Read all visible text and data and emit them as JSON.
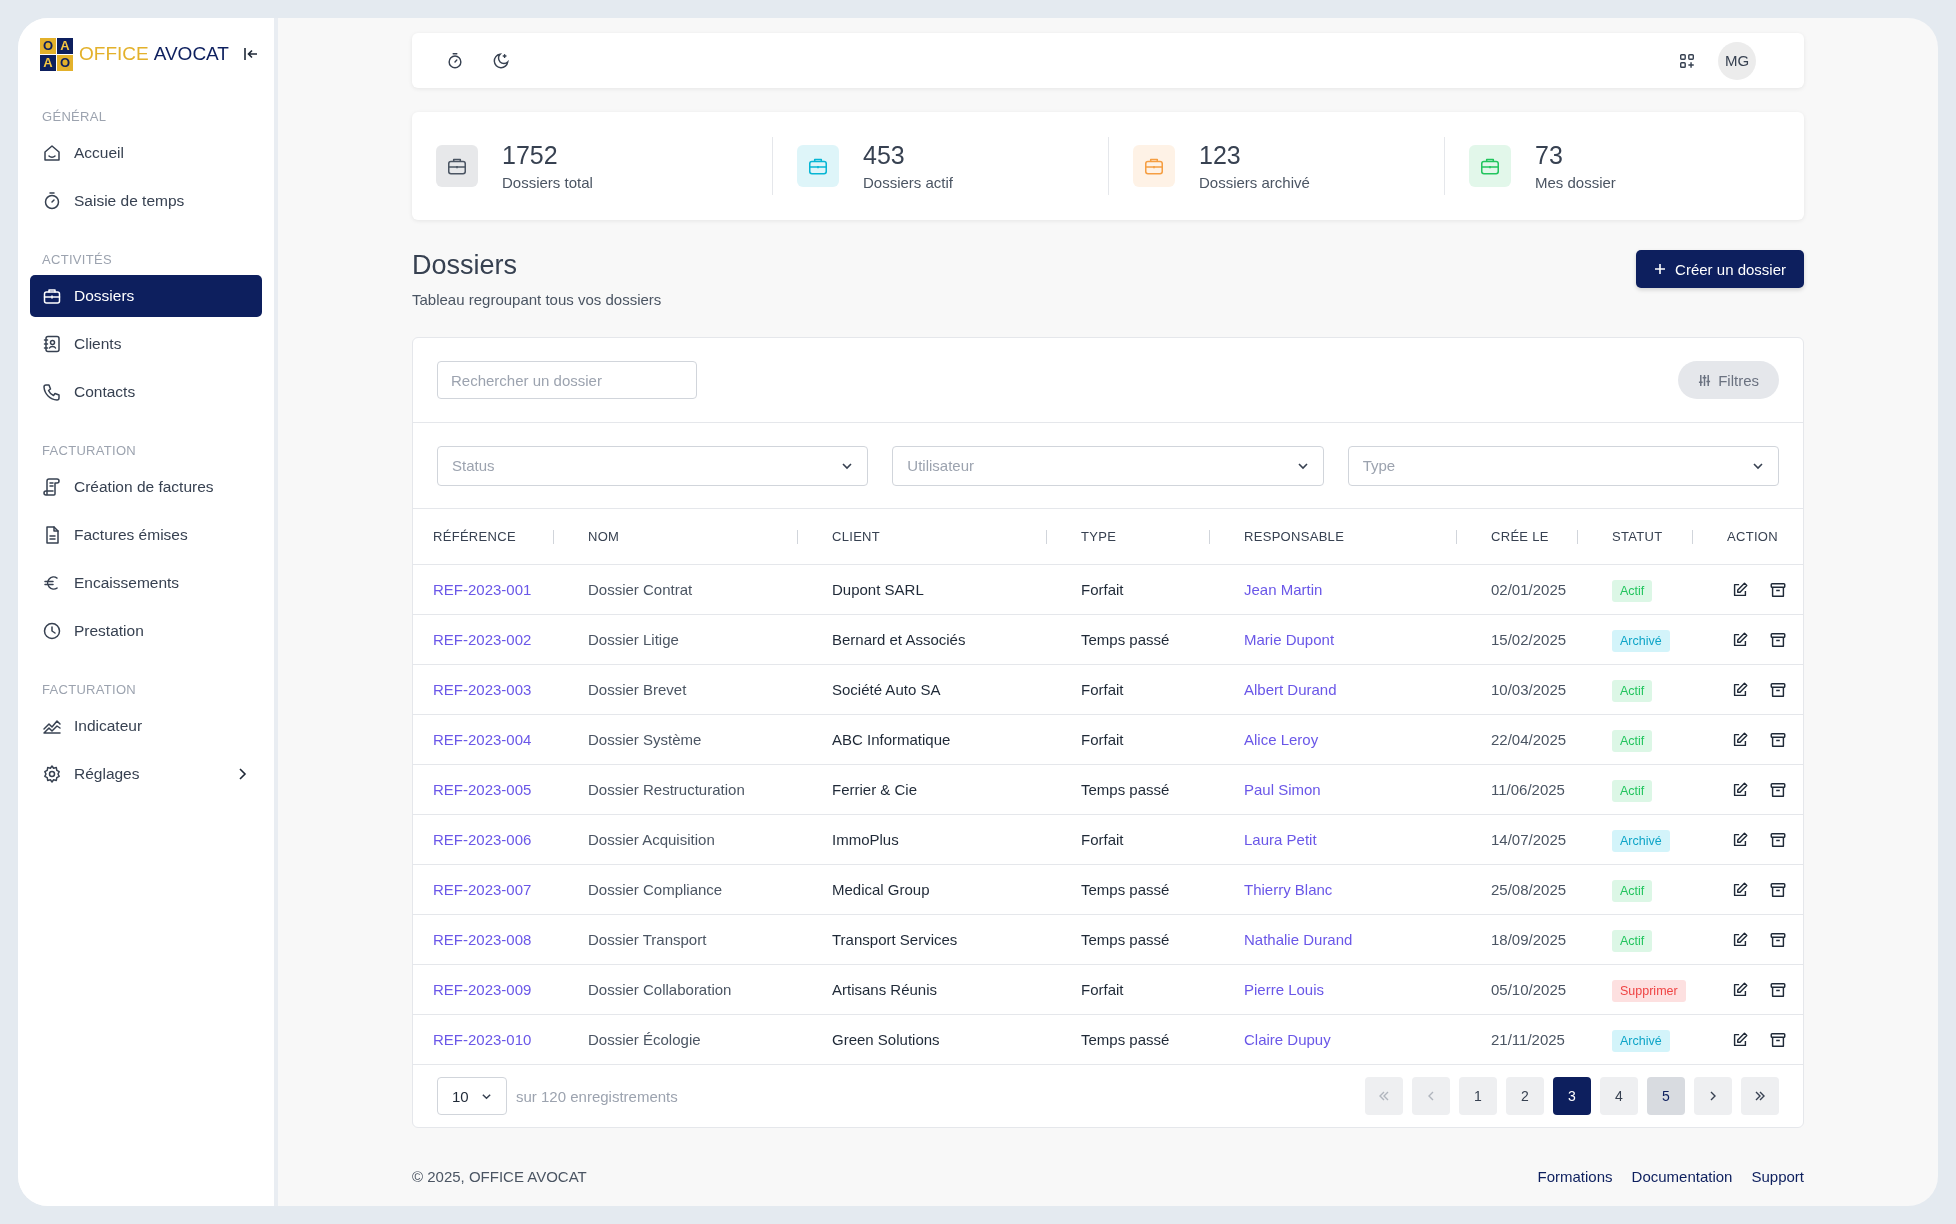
{
  "logo": {
    "tiles": [
      "O",
      "A",
      "A",
      "O"
    ],
    "word1": "OFFICE",
    "word2": "AVOCAT"
  },
  "sidebar": {
    "sections": [
      {
        "label": "GÉNÉRAL",
        "items": [
          {
            "label": "Accueil",
            "selected": false
          },
          {
            "label": "Saisie de temps",
            "selected": false
          }
        ]
      },
      {
        "label": "ACTIVITÉS",
        "items": [
          {
            "label": "Dossiers",
            "selected": true
          },
          {
            "label": "Clients",
            "selected": false
          },
          {
            "label": "Contacts",
            "selected": false
          }
        ]
      },
      {
        "label": "FACTURATION",
        "items": [
          {
            "label": "Création de factures",
            "selected": false
          },
          {
            "label": "Factures émises",
            "selected": false
          },
          {
            "label": "Encaissements",
            "selected": false
          },
          {
            "label": "Prestation",
            "selected": false
          }
        ]
      },
      {
        "label": "FACTURATION",
        "items": [
          {
            "label": "Indicateur",
            "selected": false
          },
          {
            "label": "Réglages",
            "selected": false,
            "submenu": true
          }
        ]
      }
    ]
  },
  "topbar": {
    "avatar": "MG"
  },
  "stats": [
    {
      "value": "1752",
      "label": "Dossiers total",
      "color": "#4b5563"
    },
    {
      "value": "453",
      "label": "Dossiers actif",
      "color": "#06b6d4"
    },
    {
      "value": "123",
      "label": "Dossiers archivé",
      "color": "#f59e42"
    },
    {
      "value": "73",
      "label": "Mes dossier",
      "color": "#22c55e"
    }
  ],
  "page": {
    "title": "Dossiers",
    "subtitle": "Tableau regroupant tous vos dossiers",
    "create_button": "Créer un dossier"
  },
  "search": {
    "placeholder": "Rechercher un dossier"
  },
  "filters_button": "Filtres",
  "filters": [
    {
      "placeholder": "Status"
    },
    {
      "placeholder": "Utilisateur"
    },
    {
      "placeholder": "Type"
    }
  ],
  "table": {
    "columns": [
      "RÉFÉRENCE",
      "NOM",
      "CLIENT",
      "TYPE",
      "RESPONSABLE",
      "CRÉE LE",
      "STATUT",
      "ACTION"
    ],
    "rows": [
      {
        "reference": "REF-2023-001",
        "nom": "Dossier Contrat",
        "client": "Dupont SARL",
        "type": "Forfait",
        "responsable": "Jean Martin",
        "cree_le": "02/01/2025",
        "statut": {
          "label": "Actif",
          "kind": "active"
        }
      },
      {
        "reference": "REF-2023-002",
        "nom": "Dossier Litige",
        "client": "Bernard et Associés",
        "type": "Temps passé",
        "responsable": "Marie Dupont",
        "cree_le": "15/02/2025",
        "statut": {
          "label": "Archivé",
          "kind": "archived"
        }
      },
      {
        "reference": "REF-2023-003",
        "nom": "Dossier Brevet",
        "client": "Société Auto SA",
        "type": "Forfait",
        "responsable": "Albert Durand",
        "cree_le": "10/03/2025",
        "statut": {
          "label": "Actif",
          "kind": "active"
        }
      },
      {
        "reference": "REF-2023-004",
        "nom": "Dossier Système",
        "client": "ABC Informatique",
        "type": "Forfait",
        "responsable": "Alice Leroy",
        "cree_le": "22/04/2025",
        "statut": {
          "label": "Actif",
          "kind": "active"
        }
      },
      {
        "reference": "REF-2023-005",
        "nom": "Dossier Restructuration",
        "client": "Ferrier & Cie",
        "type": "Temps passé",
        "responsable": "Paul Simon",
        "cree_le": "11/06/2025",
        "statut": {
          "label": "Actif",
          "kind": "active"
        }
      },
      {
        "reference": "REF-2023-006",
        "nom": "Dossier Acquisition",
        "client": "ImmoPlus",
        "type": "Forfait",
        "responsable": "Laura Petit",
        "cree_le": "14/07/2025",
        "statut": {
          "label": "Archivé",
          "kind": "archived"
        }
      },
      {
        "reference": "REF-2023-007",
        "nom": "Dossier Compliance",
        "client": "Medical Group",
        "type": "Temps passé",
        "responsable": "Thierry Blanc",
        "cree_le": "25/08/2025",
        "statut": {
          "label": "Actif",
          "kind": "active"
        }
      },
      {
        "reference": "REF-2023-008",
        "nom": "Dossier Transport",
        "client": "Transport Services",
        "type": "Temps passé",
        "responsable": "Nathalie Durand",
        "cree_le": "18/09/2025",
        "statut": {
          "label": "Actif",
          "kind": "active"
        }
      },
      {
        "reference": "REF-2023-009",
        "nom": "Dossier Collaboration",
        "client": "Artisans Réunis",
        "type": "Forfait",
        "responsable": "Pierre Louis",
        "cree_le": "05/10/2025",
        "statut": {
          "label": "Supprimer",
          "kind": "deleted"
        }
      },
      {
        "reference": "REF-2023-010",
        "nom": "Dossier Écologie",
        "client": "Green Solutions",
        "type": "Temps passé",
        "responsable": "Claire Dupuy",
        "cree_le": "21/11/2025",
        "statut": {
          "label": "Archivé",
          "kind": "archived"
        }
      }
    ]
  },
  "pagination": {
    "per_page": "10",
    "summary": "sur 120 enregistrements",
    "first_disabled": true,
    "prev_disabled": true,
    "pages": [
      {
        "label": "1",
        "selected": false,
        "hovered": false
      },
      {
        "label": "2",
        "selected": false,
        "hovered": false
      },
      {
        "label": "3",
        "selected": true,
        "hovered": false
      },
      {
        "label": "4",
        "selected": false,
        "hovered": false
      },
      {
        "label": "5",
        "selected": false,
        "hovered": true
      }
    ]
  },
  "footer": {
    "copyright": "© 2025, OFFICE AVOCAT",
    "links": [
      "Formations",
      "Documentation",
      "Support"
    ]
  }
}
